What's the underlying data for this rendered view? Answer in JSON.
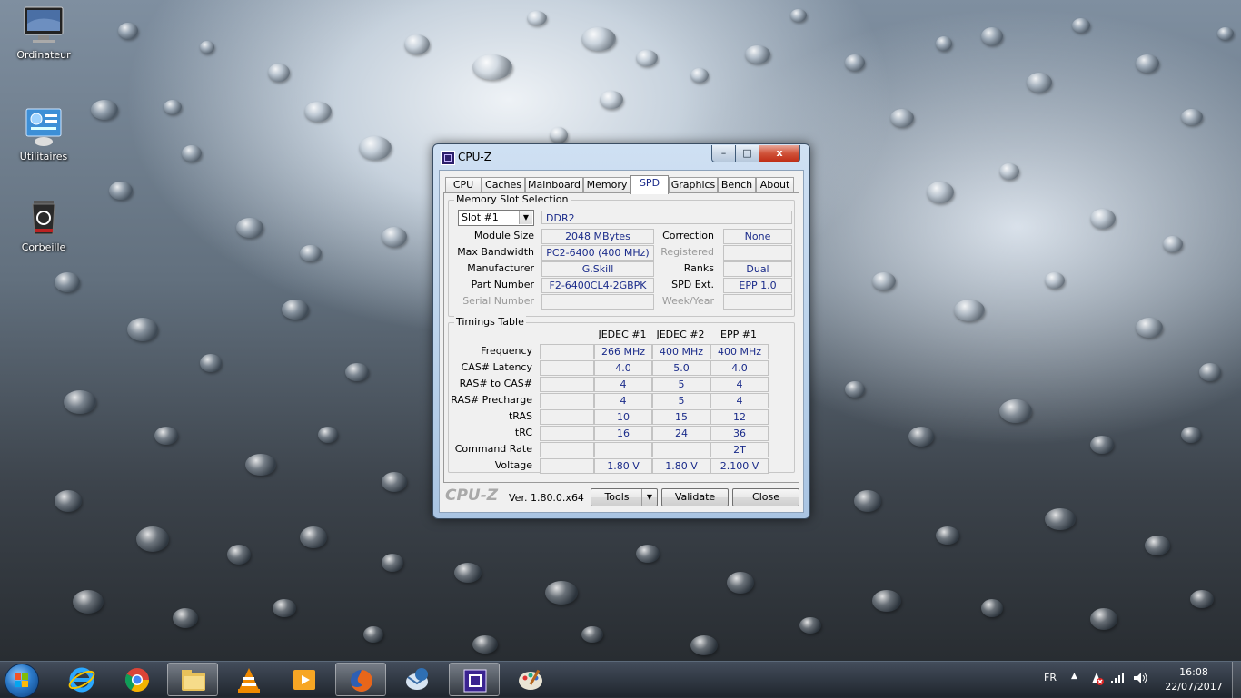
{
  "desktop": {
    "icons": [
      {
        "label": "Ordinateur"
      },
      {
        "label": "Utilitaires"
      },
      {
        "label": "Corbeille"
      }
    ]
  },
  "window": {
    "title": "CPU-Z",
    "controls": {
      "minimize": "–",
      "maximize": "□",
      "close": "x"
    }
  },
  "tabs": [
    "CPU",
    "Caches",
    "Mainboard",
    "Memory",
    "SPD",
    "Graphics",
    "Bench",
    "About"
  ],
  "active_tab": "SPD",
  "slot_group": {
    "title": "Memory Slot Selection",
    "slot_selected": "Slot #1",
    "memory_type": "DDR2",
    "rows": [
      {
        "label": "Module Size",
        "value": "2048 MBytes",
        "right_label": "Correction",
        "right_value": "None"
      },
      {
        "label": "Max Bandwidth",
        "value": "PC2-6400 (400 MHz)",
        "right_label": "Registered",
        "right_value": ""
      },
      {
        "label": "Manufacturer",
        "value": "G.Skill",
        "right_label": "Ranks",
        "right_value": "Dual"
      },
      {
        "label": "Part Number",
        "value": "F2-6400CL4-2GBPK",
        "right_label": "SPD Ext.",
        "right_value": "EPP 1.0"
      },
      {
        "label": "Serial Number",
        "value": "",
        "right_label": "Week/Year",
        "right_value": ""
      }
    ]
  },
  "timings": {
    "title": "Timings Table",
    "columns": [
      "JEDEC #1",
      "JEDEC #2",
      "EPP #1"
    ],
    "rows": [
      {
        "label": "Frequency",
        "values": [
          "266 MHz",
          "400 MHz",
          "400 MHz"
        ]
      },
      {
        "label": "CAS# Latency",
        "values": [
          "4.0",
          "5.0",
          "4.0"
        ]
      },
      {
        "label": "RAS# to CAS#",
        "values": [
          "4",
          "5",
          "4"
        ]
      },
      {
        "label": "RAS# Precharge",
        "values": [
          "4",
          "5",
          "4"
        ]
      },
      {
        "label": "tRAS",
        "values": [
          "10",
          "15",
          "12"
        ]
      },
      {
        "label": "tRC",
        "values": [
          "16",
          "24",
          "36"
        ]
      },
      {
        "label": "Command Rate",
        "values": [
          "",
          "",
          "2T"
        ]
      },
      {
        "label": "Voltage",
        "values": [
          "1.80 V",
          "1.80 V",
          "2.100 V"
        ]
      }
    ]
  },
  "footer": {
    "logo": "CPU-Z",
    "version": "Ver. 1.80.0.x64",
    "tools_label": "Tools",
    "validate_label": "Validate",
    "close_label": "Close"
  },
  "taskbar": {
    "apps": [
      "internet-explorer",
      "chrome",
      "file-explorer",
      "vlc",
      "media-player",
      "firefox",
      "thunderbird",
      "cpu-z",
      "paint"
    ],
    "language": "FR",
    "time": "16:08",
    "date": "22/07/2017"
  }
}
